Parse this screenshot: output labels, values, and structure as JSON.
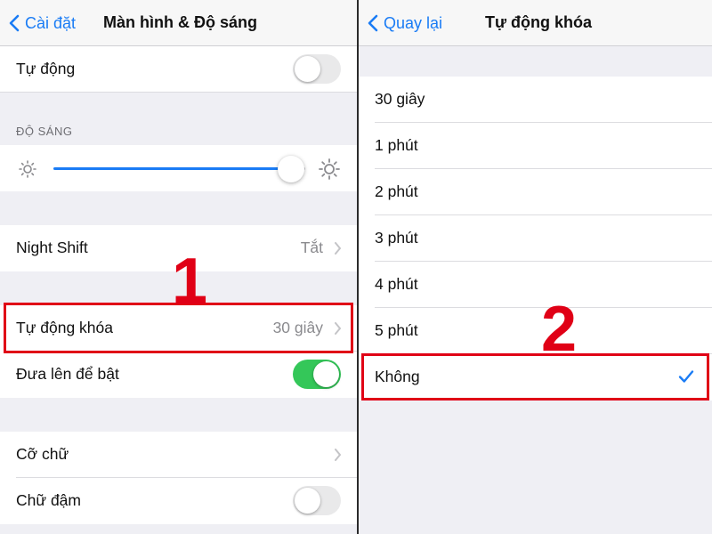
{
  "left": {
    "nav": {
      "back_label": "Cài đặt",
      "title": "Màn hình & Độ sáng"
    },
    "rows": {
      "auto": {
        "label": "Tự động",
        "toggle_on": false
      },
      "brightness_header": "ĐỘ SÁNG",
      "brightness_level": 0.945,
      "night_shift": {
        "label": "Night Shift",
        "value": "Tắt"
      },
      "auto_lock": {
        "label": "Tự động khóa",
        "value": "30 giây"
      },
      "raise_to_wake": {
        "label": "Đưa lên để bật",
        "toggle_on": true
      },
      "text_size": {
        "label": "Cỡ chữ"
      },
      "bold_text": {
        "label": "Chữ đậm",
        "toggle_on": false
      }
    },
    "step_number": "1"
  },
  "right": {
    "nav": {
      "back_label": "Quay lại",
      "title": "Tự động khóa"
    },
    "options": [
      "30 giây",
      "1 phút",
      "2 phút",
      "3 phút",
      "4 phút",
      "5 phút",
      "Không"
    ],
    "selected_option": "Không",
    "step_number": "2"
  },
  "icons": {
    "back": "chevron-left-icon",
    "disclosure": "chevron-right-icon",
    "brightness_low": "sun-small-icon",
    "brightness_high": "sun-large-icon",
    "selected": "checkmark-icon"
  },
  "colors": {
    "accent_blue": "#1a7cf5",
    "toggle_on": "#34c759",
    "annotation_red": "#e00016",
    "secondary_text": "#8a8a8e",
    "grouped_background": "#efeff4"
  }
}
